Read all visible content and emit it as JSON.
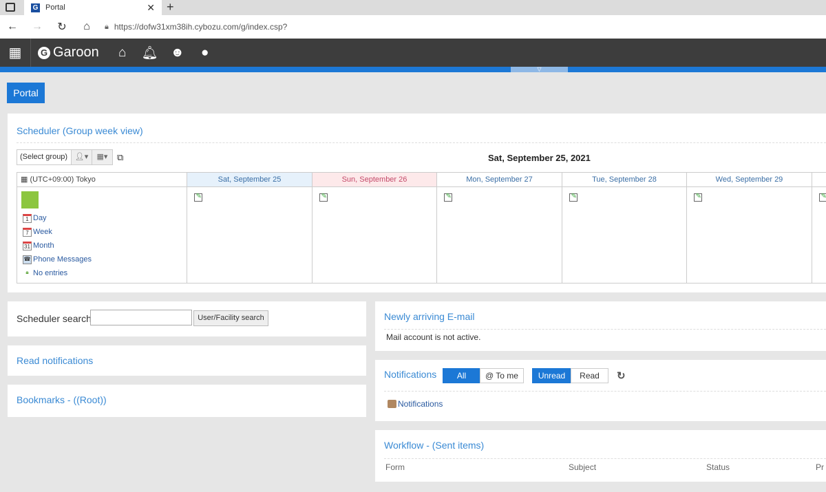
{
  "browser": {
    "tab_title": "Portal",
    "url": "https://dofw31xm38ih.cybozu.com/g/index.csp?"
  },
  "header": {
    "app_name": "Garoon",
    "icons": [
      "apps-grid-icon",
      "home-icon",
      "bell-icon",
      "smiley-icon",
      "globe-icon"
    ]
  },
  "portal_button": "Portal",
  "scheduler": {
    "title": "Scheduler (Group week view)",
    "select_group": "(Select group)",
    "current_date": "Sat, September 25, 2021",
    "timezone": "(UTC+09:00) Tokyo",
    "days": [
      {
        "label": "Sat, September 25",
        "bg": "#e6f1fb",
        "color": "#3a6ea5"
      },
      {
        "label": "Sun, September 26",
        "bg": "#fde9ea",
        "color": "#c44a6a"
      },
      {
        "label": "Mon, September 27",
        "bg": "#ffffff",
        "color": "#3a6ea5"
      },
      {
        "label": "Tue, September 28",
        "bg": "#ffffff",
        "color": "#3a6ea5"
      },
      {
        "label": "Wed, September 29",
        "bg": "#ffffff",
        "color": "#3a6ea5"
      }
    ],
    "links": [
      {
        "icon": "1",
        "label": "Day"
      },
      {
        "icon": "7",
        "label": "Week"
      },
      {
        "icon": "31",
        "label": "Month"
      },
      {
        "icon": "phone",
        "label": "Phone Messages"
      },
      {
        "icon": "lock",
        "label": "No entries"
      }
    ]
  },
  "scheduler_search": {
    "label": "Scheduler search",
    "value": "",
    "button": "User/Facility search"
  },
  "read_notifications": {
    "title": "Read notifications"
  },
  "bookmarks": {
    "title": "Bookmarks - ((Root))"
  },
  "email": {
    "title": "Newly arriving E-mail",
    "message": "Mail account is not active."
  },
  "notifications": {
    "title": "Notifications",
    "filter1": [
      "All",
      "@ To me"
    ],
    "filter2": [
      "Unread",
      "Read"
    ],
    "link": "Notifications"
  },
  "workflow": {
    "title": "Workflow - (Sent items)",
    "columns": [
      "Form",
      "Subject",
      "Status",
      "Pr"
    ]
  },
  "colors": {
    "accent": "#1c78d6",
    "header": "#3d3d3d",
    "title": "#3a8ad4"
  }
}
